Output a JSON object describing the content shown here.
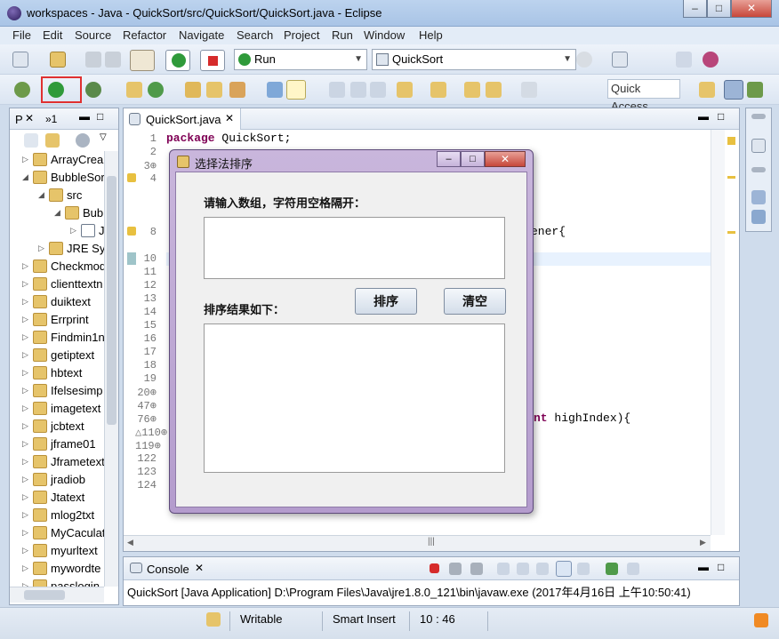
{
  "window": {
    "title": "workspaces - Java - QuickSort/src/QuickSort/QuickSort.java - Eclipse",
    "min": "–",
    "max": "□",
    "close": "✕"
  },
  "menu": [
    "File",
    "Edit",
    "Source",
    "Refactor",
    "Navigate",
    "Search",
    "Project",
    "Run",
    "Window",
    "Help"
  ],
  "toolbar": {
    "run_combo": "Run",
    "project_combo": "QuickSort",
    "quick_access": "Quick Access"
  },
  "explorer": {
    "tab_label": "P",
    "tab2_label": "»1",
    "items": [
      {
        "label": "ArrayCrea",
        "depth": 0
      },
      {
        "label": "BubbleSor",
        "depth": 0
      },
      {
        "label": "src",
        "depth": 1
      },
      {
        "label": "Bub",
        "depth": 2
      },
      {
        "label": "J",
        "depth": 3
      },
      {
        "label": "JRE Sys",
        "depth": 1
      },
      {
        "label": "Checkmod",
        "depth": 0
      },
      {
        "label": "clienttextn",
        "depth": 0
      },
      {
        "label": "duiktext",
        "depth": 0
      },
      {
        "label": "Errprint",
        "depth": 0
      },
      {
        "label": "Findmin1n",
        "depth": 0
      },
      {
        "label": "getiptext",
        "depth": 0
      },
      {
        "label": "hbtext",
        "depth": 0
      },
      {
        "label": "Ifelsesimp",
        "depth": 0
      },
      {
        "label": "imagetext",
        "depth": 0
      },
      {
        "label": "jcbtext",
        "depth": 0
      },
      {
        "label": "jframe01",
        "depth": 0
      },
      {
        "label": "Jframetext",
        "depth": 0
      },
      {
        "label": "jradiob",
        "depth": 0
      },
      {
        "label": "Jtatext",
        "depth": 0
      },
      {
        "label": "mlog2txt",
        "depth": 0
      },
      {
        "label": "MyCaculat",
        "depth": 0
      },
      {
        "label": "myurltext",
        "depth": 0
      },
      {
        "label": "mywordte",
        "depth": 0
      },
      {
        "label": "passlogin",
        "depth": 0
      }
    ]
  },
  "editor": {
    "tab_label": "QuickSort.java",
    "line_numbers": [
      "1",
      "2",
      "3⊕",
      "4",
      "",
      "",
      "8",
      "",
      "10",
      "11",
      "12",
      "13",
      "14",
      "15",
      "16",
      "17",
      "18",
      "19",
      "20⊕",
      "47⊕",
      "76⊕",
      "△110⊕",
      "119⊕",
      "122",
      "123",
      "124"
    ],
    "line1_kw": "package",
    "line1_rest": " QuickSort;",
    "line8_frag": "ener{",
    "line76_kw": "nt",
    "line76_rest": " highIndex){"
  },
  "dialog": {
    "title": "选择法排序",
    "input_label": "请输入数组，字符用空格隔开：",
    "result_label": "排序结果如下：",
    "sort_button": "排序",
    "clear_button": "清空",
    "input_value": "",
    "result_value": ""
  },
  "console": {
    "tab_label": "Console",
    "line": "QuickSort [Java Application] D:\\Program Files\\Java\\jre1.8.0_121\\bin\\javaw.exe (2017年4月16日 上午10:50:41)"
  },
  "status": {
    "writable": "Writable",
    "insert": "Smart Insert",
    "position": "10 : 46"
  },
  "colors": {
    "accent": "#4a7ab5",
    "highlight_box": "#e03030",
    "dialog_frame": "#b49ccd"
  }
}
